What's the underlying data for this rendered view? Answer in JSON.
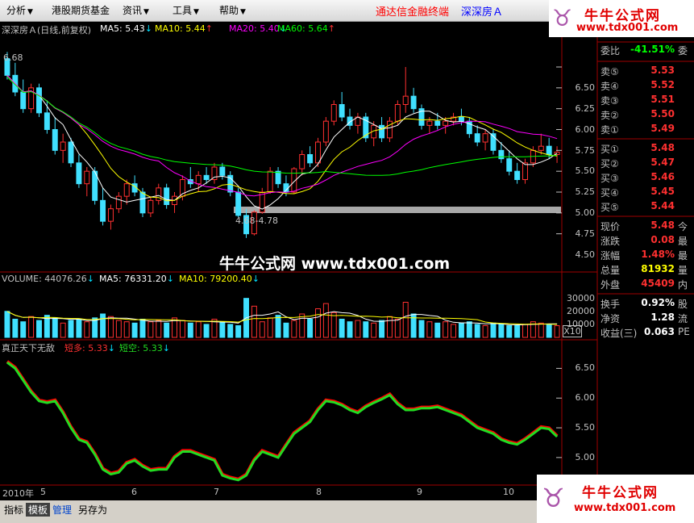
{
  "menu": [
    {
      "label": "分析",
      "arrow": "▼"
    },
    {
      "label": "港股期货基金",
      "arrow": ""
    },
    {
      "label": "资讯",
      "arrow": "▼"
    },
    {
      "label": "工具",
      "arrow": "▼"
    },
    {
      "label": "帮助",
      "arrow": "▼"
    }
  ],
  "banner": {
    "text": "通达信金融终端",
    "stock": "深深房Ａ"
  },
  "logo": {
    "title": "牛牛公式网",
    "url": "www.tdx001.com",
    "icon": "cow-icon"
  },
  "price_panel": {
    "title": "深深房Ａ(日线,前复权)",
    "ma": [
      {
        "label": "MA5: 5.43",
        "arrow": "↓",
        "color": "#ffffff"
      },
      {
        "label": "MA10: 5.44",
        "arrow": "↑",
        "color": "#ffff00"
      },
      {
        "label": "MA20: 5.40",
        "arrow": "↓",
        "color": "#ff00ff"
      },
      {
        "label": "MA60: 5.64",
        "arrow": "↑",
        "color": "#00ff00"
      }
    ],
    "high_label": "6.68",
    "range_label": "4.68-4.78",
    "y_ticks": [
      "6.50",
      "6.25",
      "6.00",
      "5.75",
      "5.50",
      "5.25",
      "5.00",
      "4.75",
      "4.50"
    ]
  },
  "volume_panel": {
    "title": "VOLUME: 44076.26",
    "ma5": "MA5: 76331.20",
    "ma10": "MA10: 79200.40",
    "y_ticks": [
      "30000",
      "20000",
      "10000"
    ],
    "unit": "X10"
  },
  "indicator_panel": {
    "title": "真正天下无敌",
    "long_label": "短多: 5.33",
    "short_label": "短空: 5.33",
    "y_ticks": [
      "6.50",
      "6.00",
      "5.50",
      "5.00"
    ]
  },
  "x_axis": [
    "2010年",
    "5",
    "6",
    "7",
    "8",
    "9",
    "10"
  ],
  "quote": [
    {
      "label": "委比",
      "value": "-41.51%",
      "extra": "委",
      "color": "#00ff00"
    },
    {
      "label": "卖⑤",
      "value": "5.53",
      "extra": "",
      "color": "#ff3030"
    },
    {
      "label": "卖④",
      "value": "5.52",
      "extra": "",
      "color": "#ff3030"
    },
    {
      "label": "卖③",
      "value": "5.51",
      "extra": "",
      "color": "#ff3030"
    },
    {
      "label": "卖②",
      "value": "5.50",
      "extra": "",
      "color": "#ff3030"
    },
    {
      "label": "卖①",
      "value": "5.49",
      "extra": "",
      "color": "#ff3030"
    },
    {
      "label": "买①",
      "value": "5.48",
      "extra": "",
      "color": "#ff3030"
    },
    {
      "label": "买②",
      "value": "5.47",
      "extra": "",
      "color": "#ff3030"
    },
    {
      "label": "买③",
      "value": "5.46",
      "extra": "",
      "color": "#ff3030"
    },
    {
      "label": "买④",
      "value": "5.45",
      "extra": "",
      "color": "#ff3030"
    },
    {
      "label": "买⑤",
      "value": "5.44",
      "extra": "",
      "color": "#ff3030"
    },
    {
      "label": "现价",
      "value": "5.48",
      "extra": "今",
      "color": "#ff3030"
    },
    {
      "label": "涨跌",
      "value": "0.08",
      "extra": "最",
      "color": "#ff3030"
    },
    {
      "label": "涨幅",
      "value": "1.48%",
      "extra": "最",
      "color": "#ff3030"
    },
    {
      "label": "总量",
      "value": "81932",
      "extra": "量",
      "color": "#ffff00"
    },
    {
      "label": "外盘",
      "value": "45409",
      "extra": "内",
      "color": "#ff3030"
    },
    {
      "label": "换手",
      "value": "0.92%",
      "extra": "股",
      "color": "#ffffff"
    },
    {
      "label": "净资",
      "value": "1.28",
      "extra": "流",
      "color": "#ffffff"
    },
    {
      "label": "收益(三)",
      "value": "0.063",
      "extra": "PE",
      "color": "#ffffff"
    }
  ],
  "watermark": "牛牛公式网 www.tdx001.com",
  "tabs": [
    {
      "label": "指标",
      "style": "normal"
    },
    {
      "label": "模板",
      "style": "active"
    },
    {
      "label": "管理",
      "style": "blue"
    },
    {
      "label": "另存为",
      "style": "normal"
    }
  ],
  "colors": {
    "up": "#ff3030",
    "down": "#40e0ff",
    "ma5": "#ffffff",
    "ma10": "#ffff00",
    "ma20": "#ff00ff",
    "ma60": "#00ff00",
    "ind_long": "#ff0000",
    "ind_short": "#22dd22"
  },
  "chart_data": {
    "type": "candlestick",
    "price_ylim": [
      4.4,
      6.8
    ],
    "candles": [
      [
        6.6,
        6.68,
        6.35,
        6.4
      ],
      [
        6.4,
        6.55,
        6.15,
        6.2
      ],
      [
        6.2,
        6.35,
        5.95,
        6.0
      ],
      [
        6.0,
        6.3,
        5.95,
        6.25
      ],
      [
        6.25,
        6.3,
        5.9,
        5.95
      ],
      [
        5.95,
        6.1,
        5.7,
        5.75
      ],
      [
        5.75,
        5.9,
        5.45,
        5.5
      ],
      [
        5.5,
        5.7,
        5.35,
        5.6
      ],
      [
        5.6,
        5.65,
        5.3,
        5.35
      ],
      [
        5.35,
        5.45,
        5.05,
        5.1
      ],
      [
        5.1,
        5.3,
        4.95,
        5.25
      ],
      [
        5.25,
        5.3,
        4.85,
        4.9
      ],
      [
        4.9,
        5.05,
        4.6,
        4.65
      ],
      [
        4.65,
        4.85,
        4.55,
        4.8
      ],
      [
        4.8,
        5.0,
        4.75,
        4.95
      ],
      [
        4.95,
        5.15,
        4.85,
        5.1
      ],
      [
        5.1,
        5.2,
        4.95,
        5.0
      ],
      [
        5.0,
        5.05,
        4.7,
        4.75
      ],
      [
        4.75,
        4.95,
        4.7,
        4.9
      ],
      [
        4.9,
        5.1,
        4.85,
        5.05
      ],
      [
        5.05,
        5.1,
        4.8,
        4.85
      ],
      [
        4.85,
        5.0,
        4.75,
        4.95
      ],
      [
        4.95,
        5.2,
        4.9,
        5.15
      ],
      [
        5.15,
        5.3,
        5.05,
        5.1
      ],
      [
        5.1,
        5.25,
        5.0,
        5.2
      ],
      [
        5.2,
        5.3,
        5.1,
        5.15
      ],
      [
        5.15,
        5.35,
        5.1,
        5.3
      ],
      [
        5.3,
        5.35,
        5.15,
        5.2
      ],
      [
        5.2,
        5.25,
        4.95,
        5.0
      ],
      [
        5.0,
        5.05,
        4.7,
        4.72
      ],
      [
        4.72,
        4.8,
        4.45,
        4.5
      ],
      [
        4.5,
        4.78,
        4.48,
        4.76
      ],
      [
        4.76,
        5.05,
        4.74,
        5.0
      ],
      [
        5.0,
        5.3,
        4.98,
        5.25
      ],
      [
        5.25,
        5.3,
        5.05,
        5.1
      ],
      [
        5.1,
        5.2,
        4.95,
        5.0
      ],
      [
        5.0,
        5.3,
        4.98,
        5.28
      ],
      [
        5.28,
        5.5,
        5.2,
        5.45
      ],
      [
        5.45,
        5.55,
        5.3,
        5.35
      ],
      [
        5.35,
        5.65,
        5.3,
        5.6
      ],
      [
        5.6,
        5.9,
        5.55,
        5.85
      ],
      [
        5.85,
        6.1,
        5.8,
        6.05
      ],
      [
        6.05,
        6.2,
        5.85,
        5.9
      ],
      [
        5.9,
        6.0,
        5.75,
        5.8
      ],
      [
        5.8,
        5.95,
        5.7,
        5.9
      ],
      [
        5.9,
        5.95,
        5.6,
        5.65
      ],
      [
        5.65,
        5.85,
        5.55,
        5.8
      ],
      [
        5.8,
        5.9,
        5.6,
        5.65
      ],
      [
        5.65,
        5.9,
        5.6,
        5.85
      ],
      [
        5.85,
        6.1,
        5.8,
        6.05
      ],
      [
        6.05,
        6.5,
        5.95,
        6.15
      ],
      [
        6.15,
        6.25,
        5.95,
        6.0
      ],
      [
        6.0,
        6.05,
        5.75,
        5.8
      ],
      [
        5.8,
        5.9,
        5.7,
        5.85
      ],
      [
        5.85,
        5.95,
        5.75,
        5.8
      ],
      [
        5.8,
        5.9,
        5.7,
        5.85
      ],
      [
        5.85,
        5.95,
        5.8,
        5.9
      ],
      [
        5.9,
        6.0,
        5.8,
        5.85
      ],
      [
        5.85,
        5.9,
        5.65,
        5.7
      ],
      [
        5.7,
        5.8,
        5.55,
        5.6
      ],
      [
        5.6,
        5.75,
        5.5,
        5.7
      ],
      [
        5.7,
        5.75,
        5.45,
        5.5
      ],
      [
        5.5,
        5.6,
        5.35,
        5.4
      ],
      [
        5.4,
        5.5,
        5.2,
        5.25
      ],
      [
        5.25,
        5.35,
        5.1,
        5.15
      ],
      [
        5.15,
        5.4,
        5.1,
        5.35
      ],
      [
        5.35,
        5.55,
        5.3,
        5.5
      ],
      [
        5.5,
        5.7,
        5.45,
        5.55
      ],
      [
        5.55,
        5.65,
        5.4,
        5.45
      ],
      [
        5.45,
        5.55,
        5.35,
        5.48
      ]
    ],
    "volume_ylim": [
      0,
      36000
    ],
    "volume": [
      20000,
      14000,
      12000,
      16000,
      13000,
      17000,
      15000,
      11000,
      13000,
      14000,
      12000,
      15000,
      18000,
      16000,
      13000,
      12000,
      11000,
      14000,
      12000,
      13000,
      11000,
      15000,
      13000,
      11000,
      12000,
      10000,
      14000,
      12000,
      10000,
      9000,
      30000,
      24000,
      12000,
      15000,
      17000,
      11000,
      13000,
      18000,
      14000,
      22000,
      26000,
      19000,
      14000,
      12000,
      13000,
      12000,
      11000,
      13000,
      16000,
      14000,
      27000,
      18000,
      13000,
      12000,
      11000,
      12000,
      10000,
      11000,
      12000,
      10000,
      9000,
      11000,
      10000,
      9000,
      9000,
      10000,
      12000,
      11000,
      10000,
      9000
    ],
    "indicator_ylim": [
      4.55,
      6.75
    ],
    "indicator": [
      6.6,
      6.5,
      6.3,
      6.1,
      5.95,
      5.92,
      5.95,
      5.75,
      5.5,
      5.3,
      5.25,
      5.05,
      4.8,
      4.72,
      4.75,
      4.9,
      4.95,
      4.85,
      4.78,
      4.8,
      4.8,
      5.0,
      5.1,
      5.1,
      5.05,
      5.0,
      4.95,
      4.7,
      4.65,
      4.62,
      4.7,
      4.95,
      5.1,
      5.05,
      5.0,
      5.2,
      5.4,
      5.5,
      5.6,
      5.8,
      5.95,
      5.93,
      5.88,
      5.8,
      5.75,
      5.85,
      5.92,
      5.98,
      6.05,
      5.9,
      5.8,
      5.8,
      5.83,
      5.83,
      5.85,
      5.8,
      5.75,
      5.7,
      5.6,
      5.5,
      5.45,
      5.4,
      5.3,
      5.25,
      5.22,
      5.3,
      5.4,
      5.5,
      5.48,
      5.35
    ]
  }
}
